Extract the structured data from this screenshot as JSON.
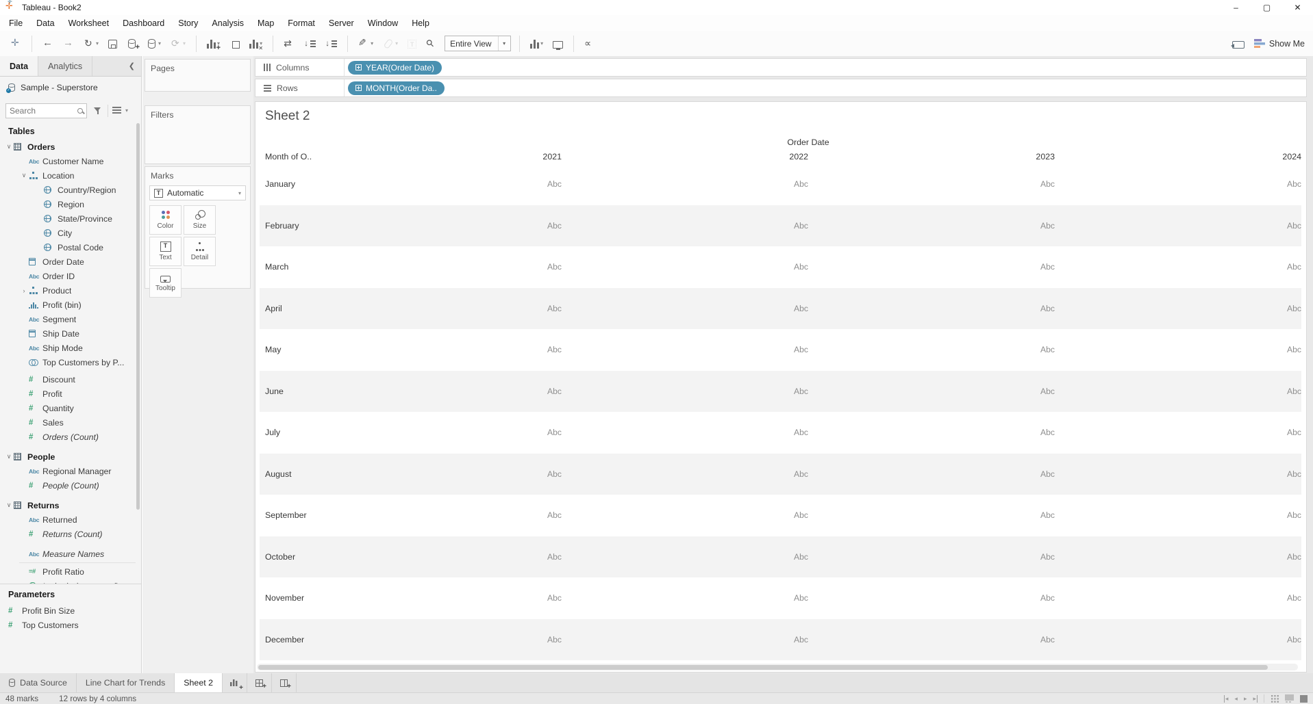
{
  "window": {
    "title": "Tableau - Book2"
  },
  "menu": {
    "items": [
      "File",
      "Data",
      "Worksheet",
      "Dashboard",
      "Story",
      "Analysis",
      "Map",
      "Format",
      "Server",
      "Window",
      "Help"
    ]
  },
  "toolbar": {
    "fit_value": "Entire View",
    "show_me_label": "Show Me",
    "items": [
      {
        "name": "tableau-logo",
        "icon": "logo"
      },
      {
        "name": "sep"
      },
      {
        "name": "back-button",
        "icon": "back"
      },
      {
        "name": "forward-button",
        "icon": "forward"
      },
      {
        "name": "undo-redo-button",
        "icon": "undo",
        "dropdown": true
      },
      {
        "name": "save-button",
        "icon": "save"
      },
      {
        "name": "add-data-source-button",
        "icon": "db-plus"
      },
      {
        "name": "data-source-menu-button",
        "icon": "db",
        "dropdown": true
      },
      {
        "name": "refresh-button",
        "icon": "refresh",
        "disabled": true,
        "dropdown": true
      },
      {
        "name": "sep"
      },
      {
        "name": "new-worksheet-button",
        "icon": "bars-plus",
        "dropdown": true
      },
      {
        "name": "duplicate-sheet-button",
        "icon": "duplicate"
      },
      {
        "name": "clear-sheet-button",
        "icon": "bars-x",
        "dropdown": true
      },
      {
        "name": "sep"
      },
      {
        "name": "swap-rows-columns-button",
        "icon": "swap"
      },
      {
        "name": "sort-ascending-button",
        "icon": "sort-asc"
      },
      {
        "name": "sort-descending-button",
        "icon": "sort-desc"
      },
      {
        "name": "sep"
      },
      {
        "name": "highlight-button",
        "icon": "pen",
        "dropdown": true
      },
      {
        "name": "group-members-button",
        "icon": "clip",
        "disabled": true,
        "dropdown": true
      },
      {
        "name": "show-mark-labels-button",
        "icon": "tbox",
        "disabled": true
      },
      {
        "name": "fix-axes-button",
        "icon": "pin"
      },
      {
        "name": "fit-view-select",
        "type": "select"
      },
      {
        "name": "sep"
      },
      {
        "name": "show-labels-button",
        "icon": "bars-label",
        "dropdown": true
      },
      {
        "name": "presentation-mode-button",
        "icon": "present"
      },
      {
        "name": "sep"
      },
      {
        "name": "share-button",
        "icon": "share"
      }
    ]
  },
  "sidebar": {
    "tabs": [
      {
        "label": "Data",
        "active": true
      },
      {
        "label": "Analytics",
        "active": false
      }
    ],
    "datasource": "Sample - Superstore",
    "search_placeholder": "Search",
    "tables_header": "Tables",
    "fields": [
      {
        "icon": "table",
        "label": "Orders",
        "bold": true,
        "expander": "open",
        "indent": 0
      },
      {
        "icon": "abc",
        "label": "Customer Name",
        "indent": 1
      },
      {
        "icon": "hier",
        "label": "Location",
        "indent": 1,
        "expander": "open"
      },
      {
        "icon": "globe",
        "label": "Country/Region",
        "indent": 2
      },
      {
        "icon": "globe",
        "label": "Region",
        "indent": 2
      },
      {
        "icon": "globe",
        "label": "State/Province",
        "indent": 2
      },
      {
        "icon": "globe",
        "label": "City",
        "indent": 2
      },
      {
        "icon": "globe",
        "label": "Postal Code",
        "indent": 2
      },
      {
        "icon": "cal",
        "label": "Order Date",
        "indent": 1
      },
      {
        "icon": "abc",
        "label": "Order ID",
        "indent": 1
      },
      {
        "icon": "hier",
        "label": "Product",
        "indent": 1,
        "expander": "closed"
      },
      {
        "icon": "bin",
        "label": "Profit (bin)",
        "indent": 1
      },
      {
        "icon": "abc",
        "label": "Segment",
        "indent": 1
      },
      {
        "icon": "cal",
        "label": "Ship Date",
        "indent": 1
      },
      {
        "icon": "abc",
        "label": "Ship Mode",
        "indent": 1
      },
      {
        "icon": "set",
        "label": "Top Customers by P...",
        "indent": 1
      },
      {
        "icon": "hash",
        "label": "Discount",
        "indent": 1,
        "gap_sm": true
      },
      {
        "icon": "hash",
        "label": "Profit",
        "indent": 1
      },
      {
        "icon": "hash",
        "label": "Quantity",
        "indent": 1
      },
      {
        "icon": "hash",
        "label": "Sales",
        "indent": 1
      },
      {
        "icon": "hash",
        "label": "Orders (Count)",
        "indent": 1,
        "italic": true
      },
      {
        "icon": "table",
        "label": "People",
        "bold": true,
        "expander": "open",
        "indent": 0,
        "gap": true
      },
      {
        "icon": "abc",
        "label": "Regional Manager",
        "indent": 1
      },
      {
        "icon": "hash",
        "label": "People (Count)",
        "indent": 1,
        "italic": true
      },
      {
        "icon": "table",
        "label": "Returns",
        "bold": true,
        "expander": "open",
        "indent": 0,
        "gap": true
      },
      {
        "icon": "abc",
        "label": "Returned",
        "indent": 1
      },
      {
        "icon": "hash",
        "label": "Returns (Count)",
        "indent": 1,
        "italic": true
      },
      {
        "icon": "abc",
        "label": "Measure Names",
        "indent": 1,
        "italic": true,
        "gap": true,
        "sep_after": true
      },
      {
        "icon": "calc",
        "label": "Profit Ratio",
        "indent": 1
      },
      {
        "icon": "globe-green",
        "label": "Latitude (generated)",
        "indent": 1,
        "italic": true
      }
    ],
    "parameters_header": "Parameters",
    "parameters": [
      {
        "icon": "hash",
        "label": "Profit Bin Size"
      },
      {
        "icon": "hash",
        "label": "Top Customers"
      }
    ]
  },
  "cards": {
    "pages_label": "Pages",
    "filters_label": "Filters",
    "marks": {
      "label": "Marks",
      "type_selected": "Automatic",
      "buttons": [
        {
          "label": "Color",
          "icon": "color"
        },
        {
          "label": "Size",
          "icon": "size"
        },
        {
          "label": "Text",
          "icon": "text"
        },
        {
          "label": "Detail",
          "icon": "detail"
        },
        {
          "label": "Tooltip",
          "icon": "tooltip"
        }
      ]
    }
  },
  "shelves": {
    "columns_label": "Columns",
    "columns_pills": [
      "YEAR(Order Date)"
    ],
    "rows_label": "Rows",
    "rows_pills": [
      "MONTH(Order Da.."
    ]
  },
  "sheet": {
    "title": "Sheet 2",
    "table": {
      "col_field_label": "Order Date",
      "row_field_label": "Month of O..",
      "years": [
        "2021",
        "2022",
        "2023",
        "2024"
      ],
      "months": [
        "January",
        "February",
        "March",
        "April",
        "May",
        "June",
        "July",
        "August",
        "September",
        "October",
        "November",
        "December"
      ],
      "cell_placeholder": "Abc"
    }
  },
  "tabs_bar": {
    "tabs": [
      {
        "label": "Data Source",
        "icon": "db"
      },
      {
        "label": "Line Chart for Trends"
      },
      {
        "label": "Sheet 2",
        "active": true
      }
    ],
    "new_buttons": [
      "new-worksheet",
      "new-dashboard",
      "new-story"
    ]
  },
  "status_bar": {
    "marks": "48 marks",
    "summary": "12 rows by 4 columns"
  },
  "colors": {
    "pill": "#4a90b0",
    "dimension": "#4c87a5",
    "measure": "#3fa275"
  }
}
